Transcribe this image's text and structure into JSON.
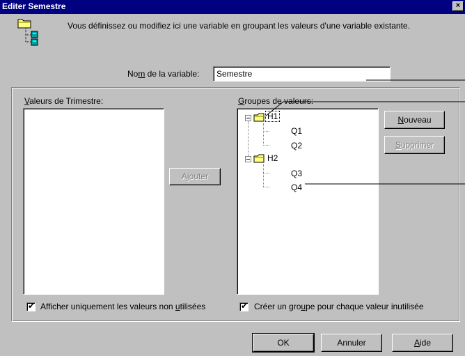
{
  "window": {
    "title": "Editer Semestre",
    "close_glyph": "×"
  },
  "description": "Vous définissez ou modifiez ici une variable en groupant les valeurs d'une variable existante.",
  "variable_name": {
    "label_pre": "No",
    "label_accel": "m",
    "label_post": " de la variable:",
    "value": "Semestre"
  },
  "left_list": {
    "label_accel": "V",
    "label_rest": "aleurs de Trimestre:",
    "items": []
  },
  "add_button": {
    "label": "Ajouter"
  },
  "groups": {
    "label_accel": "G",
    "label_rest": "roupes de valeurs:",
    "tree": [
      {
        "name": "H1",
        "children": [
          "Q1",
          "Q2"
        ]
      },
      {
        "name": "H2",
        "children": [
          "Q3",
          "Q4"
        ]
      }
    ]
  },
  "new_button": {
    "label_accel": "N",
    "label_rest": "ouveau"
  },
  "delete_button": {
    "label_accel": "S",
    "label_rest": "upprimer"
  },
  "checkbox_unused_only": {
    "checked": true,
    "glyph": "✔",
    "label_pre": "Afficher uniquement les valeurs non ",
    "label_accel": "u",
    "label_post": "tilisées"
  },
  "checkbox_group_each": {
    "checked": true,
    "glyph": "✔",
    "label_pre": "Créer un gro",
    "label_accel": "u",
    "label_post": "pe pour chaque valeur inutilisée"
  },
  "footer": {
    "ok_label": "OK",
    "cancel_label": "Annuler",
    "help_accel": "A",
    "help_rest": "ide"
  }
}
